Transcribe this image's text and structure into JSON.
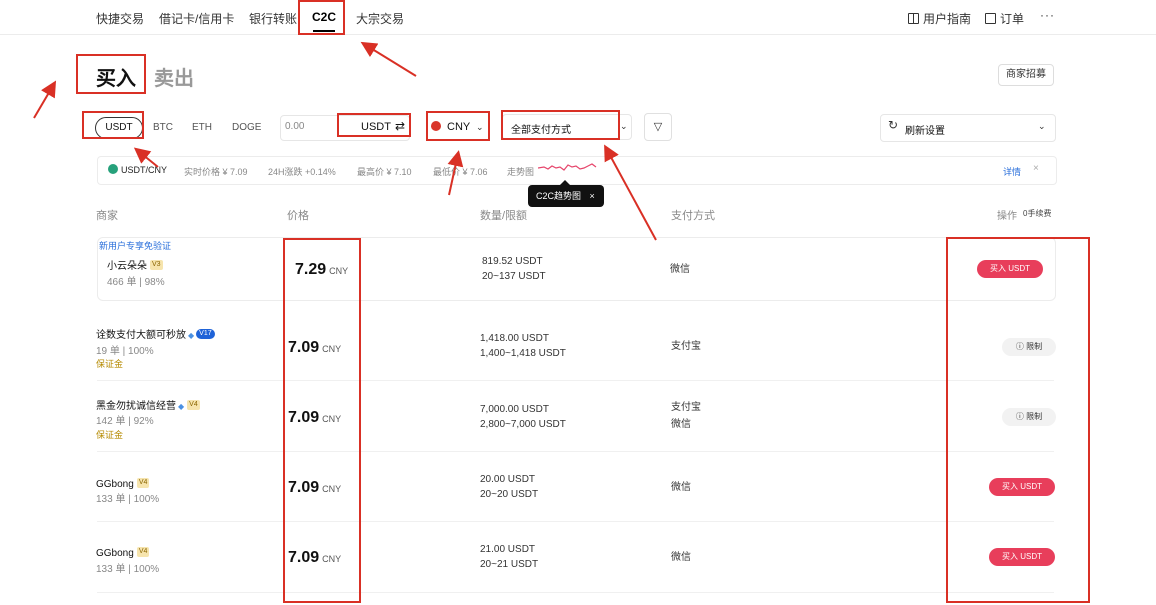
{
  "nav": {
    "items": [
      "快捷交易",
      "借记卡/信用卡",
      "银行转账",
      "C2C",
      "大宗交易"
    ],
    "right": [
      "用户指南",
      "订单",
      "···"
    ]
  },
  "tabs": {
    "buy": "买入",
    "sell": "卖出"
  },
  "recruit_label": "商家招募",
  "filters": {
    "coins": [
      "USDT",
      "BTC",
      "ETH",
      "DOGE"
    ],
    "amount_value": "0.00",
    "amount_unit": "USDT",
    "currency": "CNY",
    "payment": "全部支付方式",
    "refresh": "刷新设置"
  },
  "ticker": {
    "pair": "USDT/CNY",
    "realtime": "实时价格 ¥ 7.09",
    "change": "24H涨跌 +0.14%",
    "high": "最高价 ¥ 7.10",
    "low": "最低价 ¥ 7.06",
    "trend": "走势图",
    "detail": "详情",
    "tooltip": "C2C趋势图"
  },
  "table": {
    "headers": {
      "merchant": "商家",
      "price": "价格",
      "qty": "数量/限额",
      "pay": "支付方式",
      "action": "操作",
      "fee": "0手续费"
    },
    "rows": [
      {
        "tag": "新用户专享免验证",
        "name": "小云朵朵",
        "level": "V3",
        "stats": "466 单 | 98%",
        "deposit": "",
        "price": "7.29",
        "cny": "CNY",
        "qty1": "819.52 USDT",
        "qty2": "20~137 USDT",
        "pay1": "微信",
        "pay2": "",
        "action": "买入 USDT",
        "action_type": "buy"
      },
      {
        "tag": "",
        "name": "诠数支付大额可秒放",
        "level": "V17",
        "stats": "19 单 | 100%",
        "deposit": "保证金",
        "price": "7.09",
        "cny": "CNY",
        "qty1": "1,418.00 USDT",
        "qty2": "1,400~1,418 USDT",
        "pay1": "支付宝",
        "pay2": "",
        "action": "限制",
        "action_type": "restrict"
      },
      {
        "tag": "",
        "name": "黑金勿扰诚信经营",
        "level": "V4",
        "stats": "142 单 | 92%",
        "deposit": "保证金",
        "price": "7.09",
        "cny": "CNY",
        "qty1": "7,000.00 USDT",
        "qty2": "2,800~7,000 USDT",
        "pay1": "支付宝",
        "pay2": "微信",
        "action": "限制",
        "action_type": "restrict"
      },
      {
        "tag": "",
        "name": "GGbong",
        "level": "V4",
        "stats": "133 单 | 100%",
        "deposit": "",
        "price": "7.09",
        "cny": "CNY",
        "qty1": "20.00 USDT",
        "qty2": "20~20 USDT",
        "pay1": "微信",
        "pay2": "",
        "action": "买入 USDT",
        "action_type": "buy"
      },
      {
        "tag": "",
        "name": "GGbong",
        "level": "V4",
        "stats": "133 单 | 100%",
        "deposit": "",
        "price": "7.09",
        "cny": "CNY",
        "qty1": "21.00 USDT",
        "qty2": "20~21 USDT",
        "pay1": "微信",
        "pay2": "",
        "action": "买入 USDT",
        "action_type": "buy"
      }
    ]
  },
  "colors": {
    "accent": "#e83e5b",
    "annotation": "#d93025",
    "link": "#2a6fdb"
  }
}
